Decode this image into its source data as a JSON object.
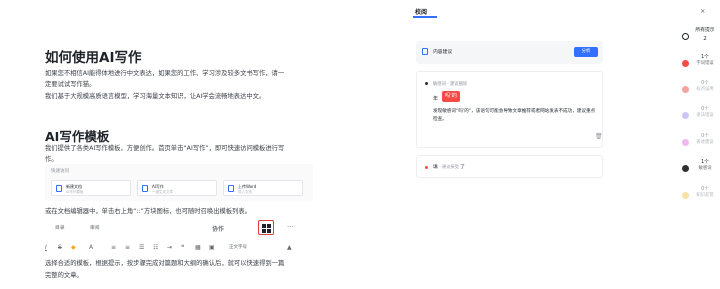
{
  "document": {
    "title": "如何使用AI写作",
    "intro_lines": [
      "如果您不相信AI能得体地进行中文表达，如果您的工作、学习涉及较多文书写作，请一",
      "定要试试写作猫。",
      "我们基于大规模高质语言模型，学习海量文本知识，让AI学会流畅地表达中文。"
    ],
    "section_title": "AI写作模板",
    "section_lines": [
      "我们提供了各类AI写作模板，方便创作。首页单击“AI写作”，即可快速访问模板进行写",
      "作。"
    ],
    "template_panel": {
      "title": "快速访问",
      "cards": [
        {
          "title": "新建文档",
          "sub": "AI写作模板"
        },
        {
          "title": "AI写作",
          "sub": "一键生成文章"
        },
        {
          "title": "上传Word",
          "sub": "导入文档"
        }
      ]
    },
    "editor_hint": "或在文档编辑器中，单击右上角“::”方块图标，也可随时召唤出模板列表。",
    "toolbar": {
      "tab1": "目录",
      "tab2": "审阅",
      "assist": "协作",
      "more": "···"
    },
    "format_bar": {
      "font_size": "正文字号",
      "chevron": "▲"
    },
    "closing_lines": [
      "选择合适的模板，根据提示，按步骤完成对篇题和大纲的确认后，就可以快速得到一篇",
      "完整的文章。"
    ]
  },
  "panel": {
    "title": "校阅",
    "close": "×",
    "content_suggestion": {
      "label": "内容建议",
      "button": "分析"
    },
    "issue": {
      "header": "敏感词 · 建议删除",
      "prefix": "年",
      "tag": "吗'的",
      "description": "发现敏感词“吗'的”，该语句可能会导致文章推荐或者网站发表不成功，建议重点检查。",
      "delete_icon": "🗑"
    },
    "issue2": {
      "word": "填",
      "hint": "· 建议接受",
      "suffix": "了"
    }
  },
  "sidebar": {
    "items": [
      {
        "count": "所有提示",
        "label": "",
        "extra": "2",
        "color": "#ffffff",
        "border": "#1f2329"
      },
      {
        "count": "1个",
        "label": "字词错误",
        "extra": "",
        "color": "#f54a45",
        "border": "#f54a45"
      },
      {
        "count": "0个",
        "label": "标点误用",
        "extra": "",
        "color": "#f5a3a1",
        "border": "#f5a3a1"
      },
      {
        "count": "0个",
        "label": "语法错误",
        "extra": "",
        "color": "#d0c4f5",
        "border": "#d0c4f5"
      },
      {
        "count": "0个",
        "label": "表述建议",
        "extra": "",
        "color": "#f0b8ef",
        "border": "#f0b8ef"
      },
      {
        "count": "1个",
        "label": "敏感词",
        "extra": "",
        "color": "#2f3033",
        "border": "#2f3033"
      },
      {
        "count": "0个",
        "label": "知识差错",
        "extra": "",
        "color": "#f7e1a3",
        "border": "#f7e1a3"
      }
    ]
  }
}
